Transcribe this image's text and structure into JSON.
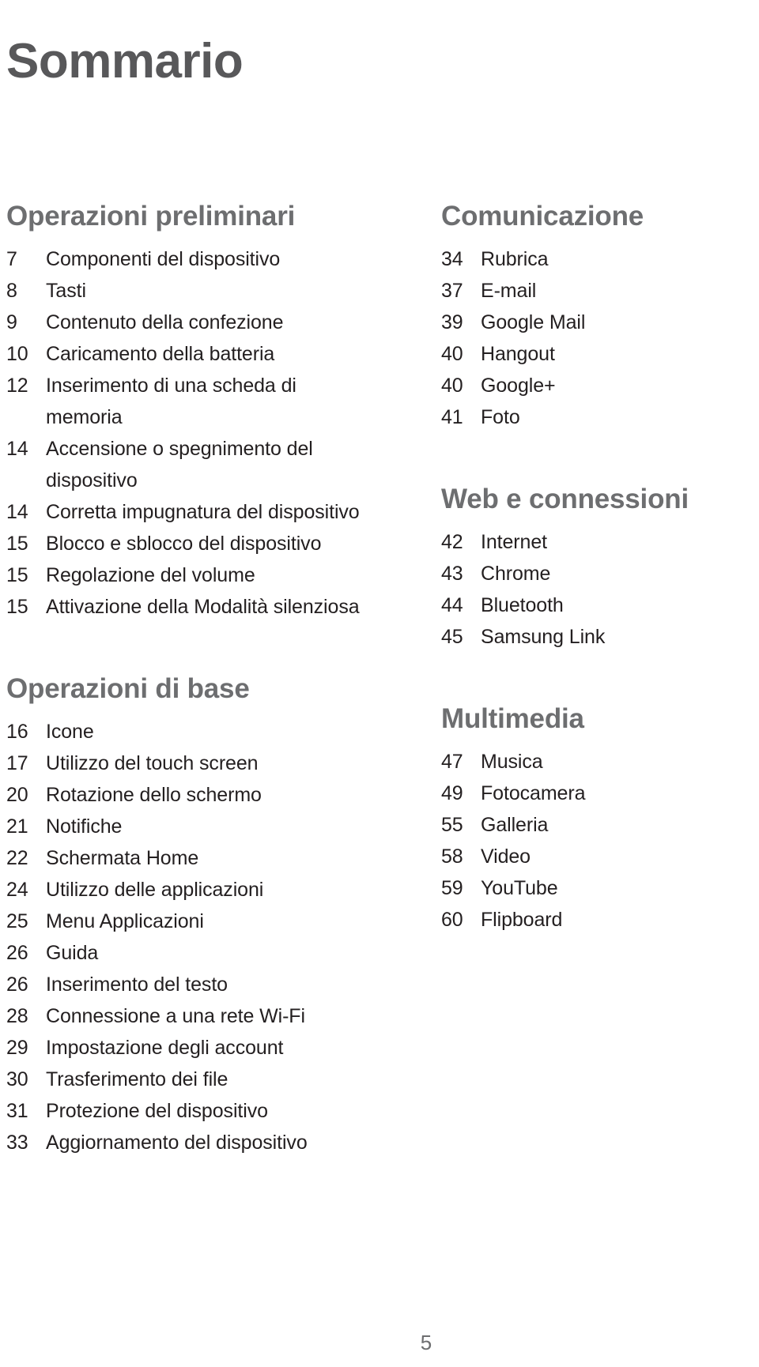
{
  "document": {
    "title": "Sommario",
    "footer_page_number": "5"
  },
  "colors": {
    "title": "#58585a",
    "section_heading": "#6d6e70",
    "entry_text": "#231f20",
    "page_number": "#6d6e70",
    "background": "#ffffff"
  },
  "columns": {
    "left": {
      "sections": [
        {
          "heading": "Operazioni preliminari",
          "entries": [
            {
              "page": "7",
              "label": "Componenti del dispositivo"
            },
            {
              "page": "8",
              "label": "Tasti"
            },
            {
              "page": "9",
              "label": "Contenuto della confezione"
            },
            {
              "page": "10",
              "label": "Caricamento della batteria"
            },
            {
              "page": "12",
              "label": "Inserimento di una scheda di memoria"
            },
            {
              "page": "14",
              "label": "Accensione o spegnimento del dispositivo"
            },
            {
              "page": "14",
              "label": "Corretta impugnatura del dispositivo"
            },
            {
              "page": "15",
              "label": "Blocco e sblocco del dispositivo"
            },
            {
              "page": "15",
              "label": "Regolazione del volume"
            },
            {
              "page": "15",
              "label": "Attivazione della Modalità silenziosa"
            }
          ]
        },
        {
          "heading": "Operazioni di base",
          "entries": [
            {
              "page": "16",
              "label": "Icone"
            },
            {
              "page": "17",
              "label": "Utilizzo del touch screen"
            },
            {
              "page": "20",
              "label": "Rotazione dello schermo"
            },
            {
              "page": "21",
              "label": "Notifiche"
            },
            {
              "page": "22",
              "label": "Schermata Home"
            },
            {
              "page": "24",
              "label": "Utilizzo delle applicazioni"
            },
            {
              "page": "25",
              "label": "Menu Applicazioni"
            },
            {
              "page": "26",
              "label": "Guida"
            },
            {
              "page": "26",
              "label": "Inserimento del testo"
            },
            {
              "page": "28",
              "label": "Connessione a una rete Wi-Fi"
            },
            {
              "page": "29",
              "label": "Impostazione degli account"
            },
            {
              "page": "30",
              "label": "Trasferimento dei file"
            },
            {
              "page": "31",
              "label": "Protezione del dispositivo"
            },
            {
              "page": "33",
              "label": "Aggiornamento del dispositivo"
            }
          ]
        }
      ]
    },
    "right": {
      "sections": [
        {
          "heading": "Comunicazione",
          "entries": [
            {
              "page": "34",
              "label": "Rubrica"
            },
            {
              "page": "37",
              "label": "E-mail"
            },
            {
              "page": "39",
              "label": "Google Mail"
            },
            {
              "page": "40",
              "label": "Hangout"
            },
            {
              "page": "40",
              "label": "Google+"
            },
            {
              "page": "41",
              "label": "Foto"
            }
          ]
        },
        {
          "heading": "Web e connessioni",
          "entries": [
            {
              "page": "42",
              "label": "Internet"
            },
            {
              "page": "43",
              "label": "Chrome"
            },
            {
              "page": "44",
              "label": "Bluetooth"
            },
            {
              "page": "45",
              "label": "Samsung Link"
            }
          ]
        },
        {
          "heading": "Multimedia",
          "entries": [
            {
              "page": "47",
              "label": "Musica"
            },
            {
              "page": "49",
              "label": "Fotocamera"
            },
            {
              "page": "55",
              "label": "Galleria"
            },
            {
              "page": "58",
              "label": "Video"
            },
            {
              "page": "59",
              "label": "YouTube"
            },
            {
              "page": "60",
              "label": "Flipboard"
            }
          ]
        }
      ]
    }
  }
}
